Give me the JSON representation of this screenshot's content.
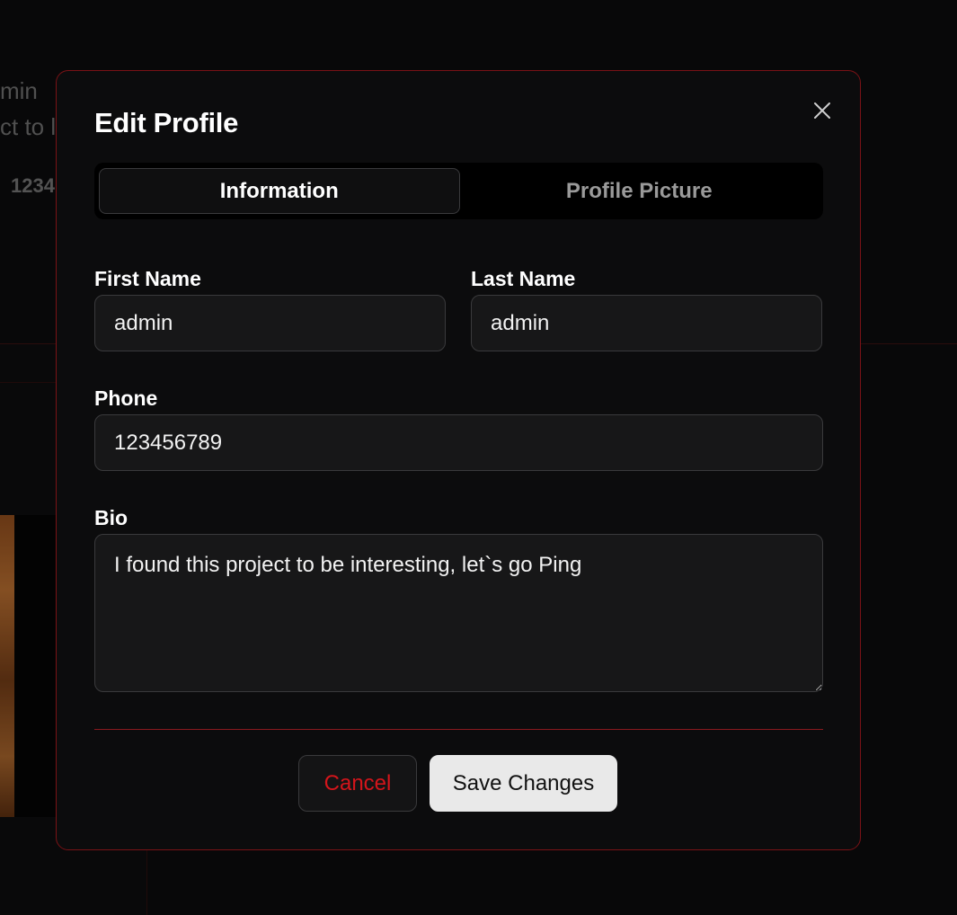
{
  "background": {
    "line1": "min",
    "line2": "ct to l",
    "line3": "1234"
  },
  "modal": {
    "title": "Edit Profile",
    "close_icon": "close-icon",
    "tabs": [
      {
        "label": "Information",
        "active": true
      },
      {
        "label": "Profile Picture",
        "active": false
      }
    ],
    "fields": {
      "first_name": {
        "label": "First Name",
        "value": "admin"
      },
      "last_name": {
        "label": "Last Name",
        "value": "admin"
      },
      "phone": {
        "label": "Phone",
        "value": "123456789"
      },
      "bio": {
        "label": "Bio",
        "value": "I found this project to be interesting, let`s go Ping"
      }
    },
    "buttons": {
      "cancel": "Cancel",
      "save": "Save Changes"
    }
  },
  "colors": {
    "accent_border": "#7a1216",
    "cancel_text": "#d4151b",
    "save_bg": "#e9e9e9"
  }
}
